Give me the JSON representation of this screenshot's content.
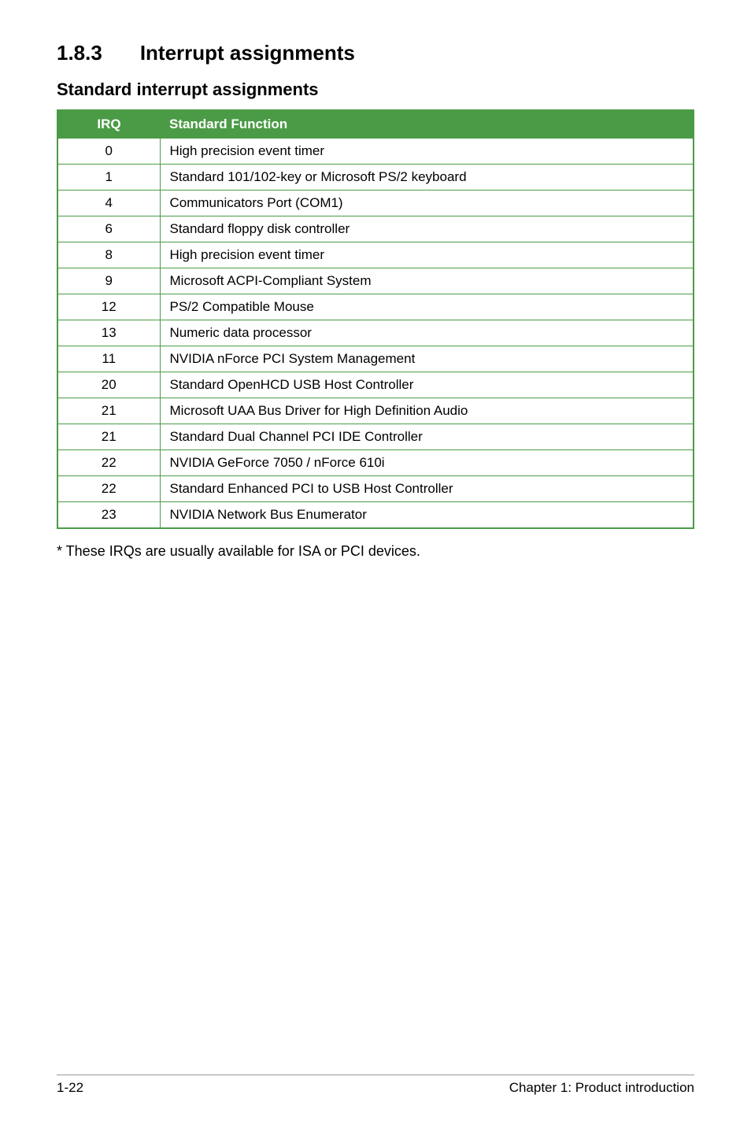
{
  "heading": {
    "number": "1.8.3",
    "title": "Interrupt assignments"
  },
  "subheading": "Standard interrupt assignments",
  "table": {
    "header_irq": "IRQ",
    "header_func": "Standard Function",
    "rows": [
      {
        "irq": "0",
        "func": "High precision event timer"
      },
      {
        "irq": "1",
        "func": "Standard 101/102-key or Microsoft PS/2 keyboard"
      },
      {
        "irq": "4",
        "func": "Communicators Port (COM1)"
      },
      {
        "irq": "6",
        "func": "Standard floppy disk controller"
      },
      {
        "irq": "8",
        "func": "High precision event timer"
      },
      {
        "irq": "9",
        "func": "Microsoft ACPI-Compliant System"
      },
      {
        "irq": "12",
        "func": "PS/2 Compatible Mouse"
      },
      {
        "irq": "13",
        "func": "Numeric data processor"
      },
      {
        "irq": "11",
        "func": "NVIDIA nForce PCI System Management"
      },
      {
        "irq": "20",
        "func": "Standard OpenHCD USB Host Controller"
      },
      {
        "irq": "21",
        "func": "Microsoft UAA Bus Driver for High Definition Audio"
      },
      {
        "irq": "21",
        "func": "Standard Dual Channel PCI IDE Controller"
      },
      {
        "irq": "22",
        "func": "NVIDIA GeForce 7050 / nForce 610i"
      },
      {
        "irq": "22",
        "func": "Standard Enhanced PCI to USB Host Controller"
      },
      {
        "irq": "23",
        "func": "NVIDIA Network Bus Enumerator"
      }
    ]
  },
  "footnote": "* These IRQs are usually available for ISA or PCI devices.",
  "footer": {
    "page": "1-22",
    "chapter": "Chapter 1: Product introduction"
  }
}
